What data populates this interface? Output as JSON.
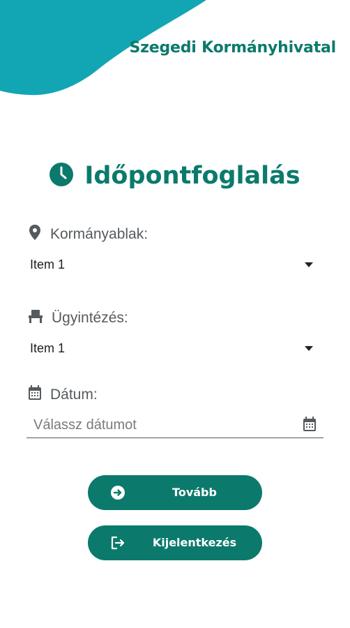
{
  "header": {
    "org_name": "Szegedi Kormányhivatal",
    "accent_color": "#12a6b4"
  },
  "title": {
    "text": "Időpontfoglalás",
    "icon": "clock-icon"
  },
  "form": {
    "office": {
      "label": "Kormányablak:",
      "icon": "location-pin-icon",
      "selected": "Item 1"
    },
    "case_type": {
      "label": "Ügyintézés:",
      "icon": "desk-chair-icon",
      "selected": "Item 1"
    },
    "date": {
      "label": "Dátum:",
      "icon": "calendar-icon",
      "placeholder": "Válassz dátumot",
      "value": ""
    }
  },
  "buttons": {
    "next": {
      "label": "Tovább",
      "icon": "arrow-right-circle-icon"
    },
    "logout": {
      "label": "Kijelentkezés",
      "icon": "logout-icon"
    }
  },
  "colors": {
    "primary": "#0b7a6c",
    "text_muted": "#555a5e"
  }
}
